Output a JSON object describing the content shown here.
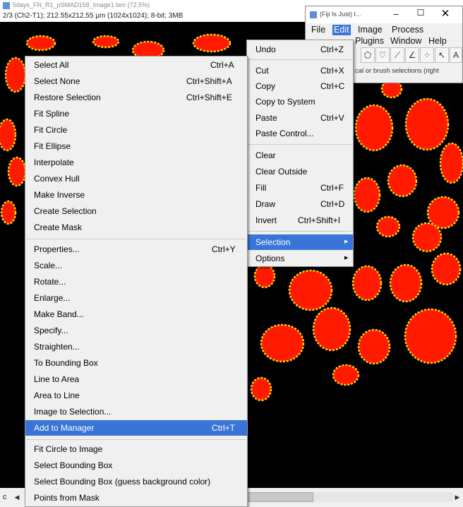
{
  "image_window": {
    "title": "5days_FN_R1_pSMAD158_Image1.lsm (72.5%)",
    "info": "2/3 (Ch2-T1); 212.55x212.55 µm (1024x1024); 8-bit; 3MB",
    "scroll_label": "c"
  },
  "fiji_window": {
    "title": "(Fiji Is Just) I...",
    "controls": {
      "minimize": "–",
      "maximize": "☐",
      "close": "✕"
    },
    "menus": [
      "File",
      "Edit",
      "Image",
      "Process",
      "Plugins",
      "Window",
      "Help"
    ],
    "active_menu": "Edit",
    "status": "cal or brush selections (right"
  },
  "edit_menu": {
    "items": [
      {
        "label": "Undo",
        "shortcut": "Ctrl+Z"
      },
      {
        "label": "Cut",
        "shortcut": "Ctrl+X"
      },
      {
        "label": "Copy",
        "shortcut": "Ctrl+C"
      },
      {
        "label": "Copy to System",
        "shortcut": ""
      },
      {
        "label": "Paste",
        "shortcut": "Ctrl+V"
      },
      {
        "label": "Paste Control...",
        "shortcut": ""
      },
      {
        "label": "Clear",
        "shortcut": ""
      },
      {
        "label": "Clear Outside",
        "shortcut": ""
      },
      {
        "label": "Fill",
        "shortcut": "Ctrl+F"
      },
      {
        "label": "Draw",
        "shortcut": "Ctrl+D"
      },
      {
        "label": "Invert",
        "shortcut": "Ctrl+Shift+I"
      },
      {
        "label": "Selection",
        "shortcut": ""
      },
      {
        "label": "Options",
        "shortcut": ""
      }
    ]
  },
  "selection_menu": {
    "items": [
      {
        "label": "Select All",
        "shortcut": "Ctrl+A"
      },
      {
        "label": "Select None",
        "shortcut": "Ctrl+Shift+A"
      },
      {
        "label": "Restore Selection",
        "shortcut": "Ctrl+Shift+E"
      },
      {
        "label": "Fit Spline",
        "shortcut": ""
      },
      {
        "label": "Fit Circle",
        "shortcut": ""
      },
      {
        "label": "Fit Ellipse",
        "shortcut": ""
      },
      {
        "label": "Interpolate",
        "shortcut": ""
      },
      {
        "label": "Convex Hull",
        "shortcut": ""
      },
      {
        "label": "Make Inverse",
        "shortcut": ""
      },
      {
        "label": "Create Selection",
        "shortcut": ""
      },
      {
        "label": "Create Mask",
        "shortcut": ""
      },
      {
        "label": "Properties...",
        "shortcut": "Ctrl+Y"
      },
      {
        "label": "Scale...",
        "shortcut": ""
      },
      {
        "label": "Rotate...",
        "shortcut": ""
      },
      {
        "label": "Enlarge...",
        "shortcut": ""
      },
      {
        "label": "Make Band...",
        "shortcut": ""
      },
      {
        "label": "Specify...",
        "shortcut": ""
      },
      {
        "label": "Straighten...",
        "shortcut": ""
      },
      {
        "label": "To Bounding Box",
        "shortcut": ""
      },
      {
        "label": "Line to Area",
        "shortcut": ""
      },
      {
        "label": "Area to Line",
        "shortcut": ""
      },
      {
        "label": "Image to Selection...",
        "shortcut": ""
      },
      {
        "label": "Add to Manager",
        "shortcut": "Ctrl+T"
      },
      {
        "label": "Fit Circle to Image",
        "shortcut": ""
      },
      {
        "label": "Select Bounding Box",
        "shortcut": ""
      },
      {
        "label": "Select Bounding Box (guess background color)",
        "shortcut": ""
      },
      {
        "label": "Points from Mask",
        "shortcut": ""
      }
    ]
  },
  "colors": {
    "highlight": "#3875d7",
    "cell_fill": "#ff1a00",
    "cell_outline": "#ffd200",
    "background": "#000000"
  }
}
